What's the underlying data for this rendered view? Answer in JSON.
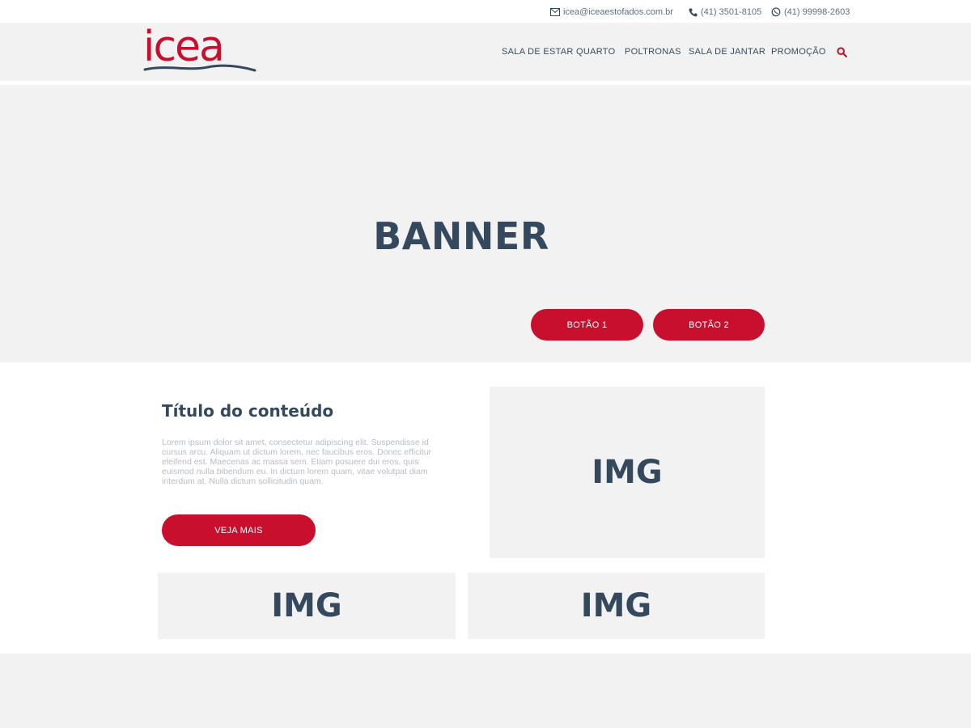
{
  "topbar": {
    "email": "icea@iceaestofados.com.br",
    "phone": "(41) 3501-8105",
    "whatsapp": "(41) 99998-2603",
    "icons": [
      "envelope-icon",
      "phone-icon",
      "whatsapp-icon"
    ]
  },
  "header": {
    "logo_text": "icea",
    "nav": [
      "SALA DE ESTAR",
      "QUARTO",
      "POLTRONAS",
      "SALA DE JANTAR",
      "PROMOÇÃO"
    ],
    "search_icon": "search-icon"
  },
  "banner": {
    "title": "BANNER",
    "button1": "BOTÃO 1",
    "button2": "BOTÃO 2"
  },
  "content": {
    "title": "Título do conteúdo",
    "text": "Lorem ipsum dolor sit amet, consectetur adipiscing elit. Suspendisse id cursus arcu. Aliquam ut dictum lorem, nec faucibus eros. Donec efficitur eleifend est. Maecenas ac massa sem. Etiam posuere dui eros, quis euismod nulla bibendum eu. In dictum lorem quam, vitae volutpat diam interdum at. Nulla dictum sollicitudin quam.",
    "button": "VEJA MAIS",
    "images": [
      "IMG",
      "IMG",
      "IMG"
    ]
  },
  "colors": {
    "accent": "#c8102e",
    "text_dark": "#34495e",
    "background": "#f2f2f2"
  }
}
